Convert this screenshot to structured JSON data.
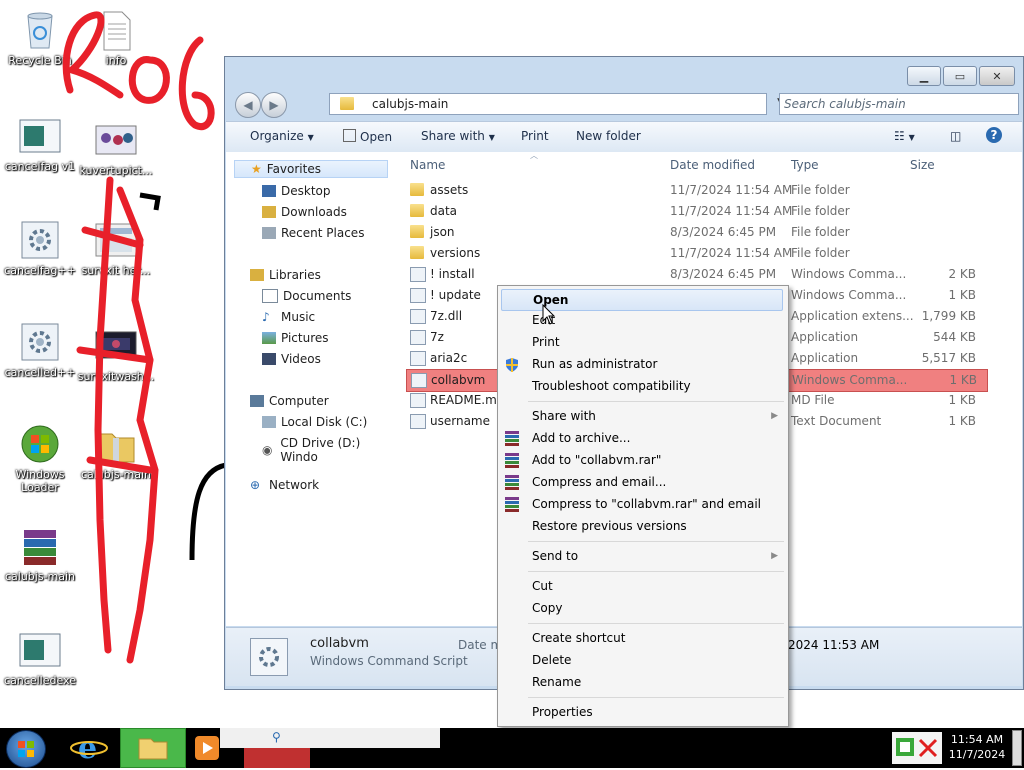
{
  "desktop": {
    "icons": [
      {
        "label": "Recycle Bin",
        "icon": "recycle-bin-icon"
      },
      {
        "label": "info",
        "icon": "text-document-icon"
      },
      {
        "label": "cancelfag v1",
        "icon": "app-window-icon"
      },
      {
        "label": "kuvertupict...",
        "icon": "image-icon"
      },
      {
        "label": "cancelfag++",
        "icon": "gear-script-icon"
      },
      {
        "label": "survxit her...",
        "icon": "image-icon"
      },
      {
        "label": "cancelled++",
        "icon": "gear-script-icon"
      },
      {
        "label": "survxitwash...",
        "icon": "image-icon"
      },
      {
        "label": "Windows Loader",
        "icon": "windows-loader-icon"
      },
      {
        "label": "calubjs-main",
        "icon": "zip-folder-icon"
      },
      {
        "label": "calubjs-main",
        "icon": "winrar-icon"
      },
      {
        "label": "cancelledexe",
        "icon": "app-window-icon"
      }
    ]
  },
  "explorer": {
    "address": "calubjs-main",
    "search_placeholder": "Search calubjs-main",
    "toolbar": {
      "organize": "Organize",
      "open": "Open",
      "share_with": "Share with",
      "print": "Print",
      "new_folder": "New folder"
    },
    "nav": {
      "favorites": "Favorites",
      "desktop": "Desktop",
      "downloads": "Downloads",
      "recent": "Recent Places",
      "libraries": "Libraries",
      "documents": "Documents",
      "music": "Music",
      "pictures": "Pictures",
      "videos": "Videos",
      "computer": "Computer",
      "local_disk": "Local Disk (C:)",
      "cd_drive": "CD Drive (D:) Windo",
      "network": "Network"
    },
    "columns": {
      "name": "Name",
      "date": "Date modified",
      "type": "Type",
      "size": "Size"
    },
    "files": [
      {
        "name": "assets",
        "date": "11/7/2024 11:54 AM",
        "type": "File folder",
        "size": "",
        "kind": "folder"
      },
      {
        "name": "data",
        "date": "11/7/2024 11:54 AM",
        "type": "File folder",
        "size": "",
        "kind": "folder"
      },
      {
        "name": "json",
        "date": "8/3/2024 6:45 PM",
        "type": "File folder",
        "size": "",
        "kind": "folder"
      },
      {
        "name": "versions",
        "date": "11/7/2024 11:54 AM",
        "type": "File folder",
        "size": "",
        "kind": "folder"
      },
      {
        "name": "! install",
        "date": "8/3/2024 6:45 PM",
        "type": "Windows Comma...",
        "size": "2 KB",
        "kind": "cmd"
      },
      {
        "name": "! update",
        "date": "",
        "type": "Windows Comma...",
        "size": "1 KB",
        "kind": "cmd"
      },
      {
        "name": "7z.dll",
        "date": "",
        "type": "Application extens...",
        "size": "1,799 KB",
        "kind": "dll"
      },
      {
        "name": "7z",
        "date": "",
        "type": "Application",
        "size": "544 KB",
        "kind": "exe"
      },
      {
        "name": "aria2c",
        "date": "",
        "type": "Application",
        "size": "5,517 KB",
        "kind": "exe"
      },
      {
        "name": "collabvm",
        "date": "",
        "type": "Windows Comma...",
        "size": "1 KB",
        "kind": "cmd",
        "selected": true
      },
      {
        "name": "README.md",
        "date": "",
        "type": "MD File",
        "size": "1 KB",
        "kind": "doc"
      },
      {
        "name": "username",
        "date": "",
        "type": "Text Document",
        "size": "1 KB",
        "kind": "doc"
      }
    ],
    "details": {
      "name": "collabvm",
      "type": "Windows Command Script",
      "date_label": "Date m",
      "date_value": "2024 11:53 AM"
    }
  },
  "context_menu": {
    "items": [
      {
        "label": "Open",
        "bold": true
      },
      {
        "label": "Edit"
      },
      {
        "label": "Print"
      },
      {
        "label": "Run as administrator",
        "icon": "shield-icon"
      },
      {
        "label": "Troubleshoot compatibility"
      },
      {
        "label": "Share with",
        "submenu": true
      },
      {
        "label": "Add to archive...",
        "icon": "winrar-icon"
      },
      {
        "label": "Add to \"collabvm.rar\"",
        "icon": "winrar-icon"
      },
      {
        "label": "Compress and email...",
        "icon": "winrar-icon"
      },
      {
        "label": "Compress to \"collabvm.rar\" and email",
        "icon": "winrar-icon"
      },
      {
        "label": "Restore previous versions"
      },
      {
        "label": "Send to",
        "submenu": true
      },
      {
        "label": "Cut"
      },
      {
        "label": "Copy"
      },
      {
        "label": "Create shortcut"
      },
      {
        "label": "Delete"
      },
      {
        "label": "Rename"
      },
      {
        "label": "Properties"
      }
    ]
  },
  "taskbar": {
    "time": "11:54 AM",
    "date": "11/7/2024"
  },
  "colors": {
    "scribble": "#e8202a",
    "selection": "#f08080",
    "window_frame": "#c8dbef"
  }
}
